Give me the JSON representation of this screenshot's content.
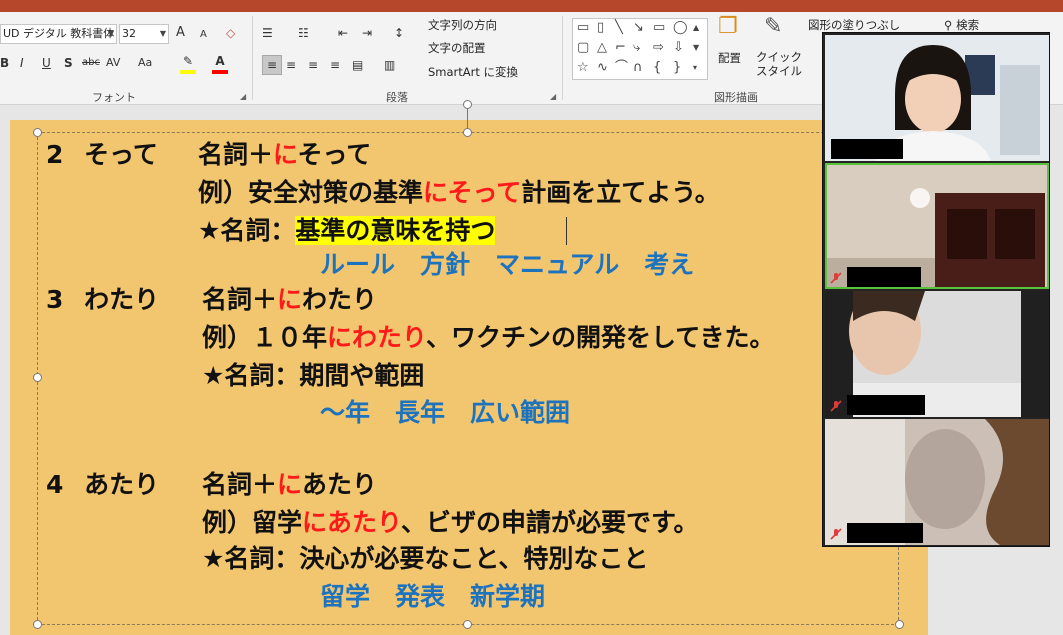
{
  "ribbon": {
    "font": {
      "family_value": "UD デジタル 教科書体",
      "size_value": "32",
      "label": "フォント",
      "grow": "A",
      "shrink": "A",
      "bold": "B",
      "italic": "I",
      "underline": "U",
      "shadow": "S",
      "strike": "abc",
      "spacing": "AV",
      "case": "Aa",
      "color": "A"
    },
    "paragraph": {
      "label": "段落",
      "text_direction": "文字列の方向",
      "align_text": "文字の配置",
      "smartart": "SmartArt に変換"
    },
    "drawing": {
      "label": "図形描画",
      "arrange": "配置",
      "quick_styles": "クイック\nスタイル",
      "shape_fill": "図形の塗りつぶし"
    },
    "search": "検索"
  },
  "slide": {
    "s2": {
      "num": "2",
      "head": "そって",
      "pattern_pre": "名詞＋",
      "pattern_red": "に",
      "pattern_post": "そって",
      "ex_pre": "例）安全対策の基準",
      "ex_red": "にそって",
      "ex_post": "計画を立てよう。",
      "noun_label": "★名詞：",
      "noun_value": "基準の意味を持つ",
      "examples": "ルール　方針　マニュアル　考え"
    },
    "s3": {
      "num": "3",
      "head": "わたり",
      "pattern_pre": "名詞＋",
      "pattern_red": "に",
      "pattern_post": "わたり",
      "ex_pre": "例）１０年",
      "ex_red": "にわたり",
      "ex_post": "、ワクチンの開発をしてきた。",
      "noun_label": "★名詞：",
      "noun_value": "期間や範囲",
      "examples": "〜年　長年　広い範囲"
    },
    "s4": {
      "num": "4",
      "head": "あたり",
      "pattern_pre": "名詞＋",
      "pattern_red": "に",
      "pattern_post": "あたり",
      "ex_pre": "例）留学",
      "ex_red": "にあたり",
      "ex_post": "、ビザの申請が必要です。",
      "noun_label": "★名詞：",
      "noun_value": "決心が必要なこと、特別なこと",
      "examples": "留学　発表　新学期"
    }
  },
  "colors": {
    "slide_bg": "#f2c66f",
    "red": "#ff1a1a",
    "blue": "#1e73be",
    "highlight": "#ffff00",
    "active_speaker": "#57c23a",
    "title_bar": "#b7472a"
  }
}
